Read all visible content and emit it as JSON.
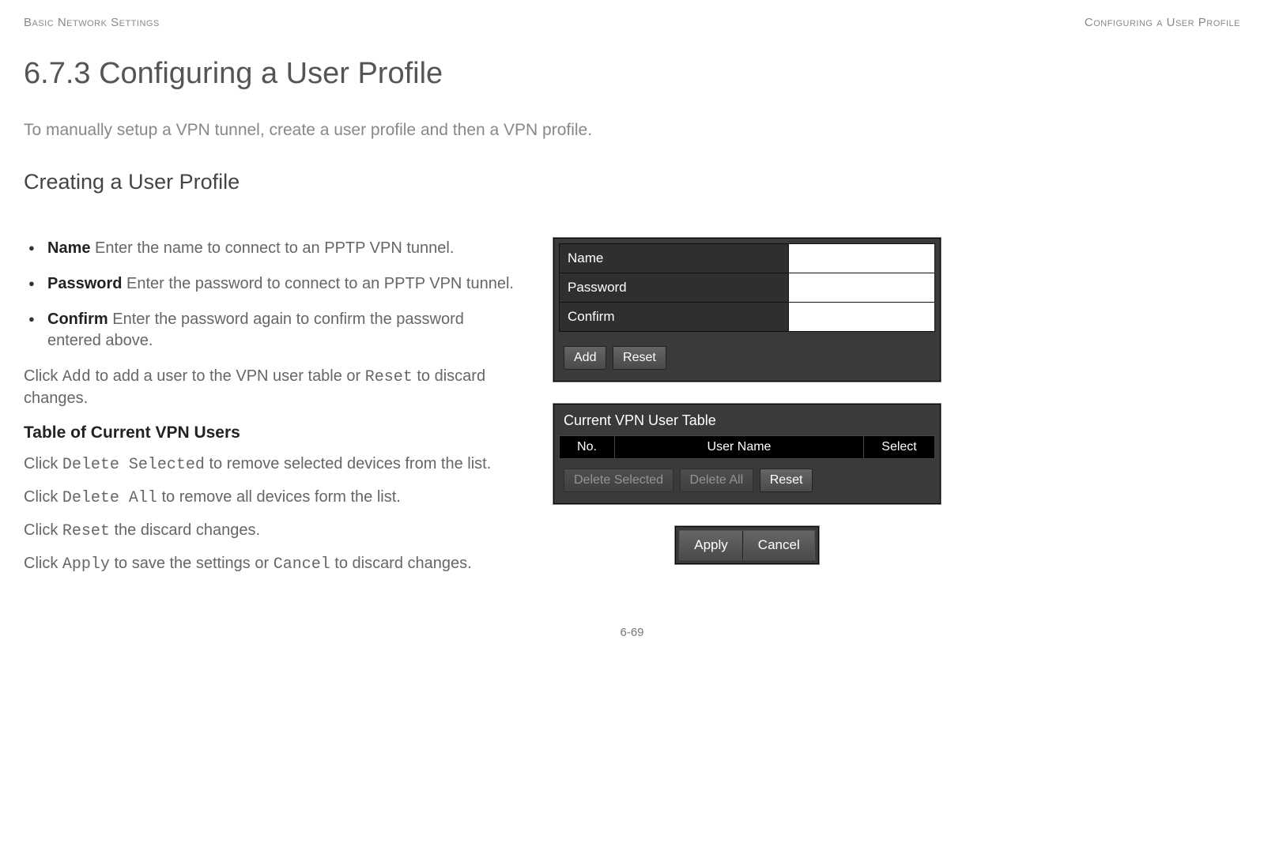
{
  "header": {
    "left": "Basic Network Settings",
    "right": "Configuring a User Profile"
  },
  "title": "6.7.3 Configuring a User Profile",
  "intro": "To manually setup a VPN tunnel, create a user profile and then a VPN profile.",
  "subtitle": "Creating a User Profile",
  "bullets": [
    {
      "label": "Name",
      "text": "  Enter the name to connect to an PPTP VPN tunnel."
    },
    {
      "label": "Password",
      "text": "  Enter the password to connect to an PPTP VPN tunnel."
    },
    {
      "label": "Confirm",
      "text": "  Enter the password again to confirm the password entered above."
    }
  ],
  "para_add": {
    "pre": "Click ",
    "m1": "Add",
    "mid": " to add a user to the VPN user table or ",
    "m2": "Reset",
    "post": " to discard changes."
  },
  "subhead": "Table of Current VPN Users",
  "para_del_sel": {
    "pre": "Click ",
    "m1": "Delete Selected",
    "post": " to remove selected devices from the list."
  },
  "para_del_all": {
    "pre": "Click ",
    "m1": "Delete All",
    "post": " to remove all devices form the list."
  },
  "para_reset": {
    "pre": "Click ",
    "m1": "Reset",
    "post": " the discard changes."
  },
  "para_apply": {
    "pre": "Click ",
    "m1": "Apply",
    "mid": " to save the settings or ",
    "m2": "Cancel",
    "post": " to discard changes."
  },
  "panel1": {
    "rows": [
      "Name",
      "Password",
      "Confirm"
    ],
    "add": "Add",
    "reset": "Reset"
  },
  "panel2": {
    "title": "Current VPN User Table",
    "cols": [
      "No.",
      "User Name",
      "Select"
    ],
    "del_sel": "Delete Selected",
    "del_all": "Delete All",
    "reset": "Reset"
  },
  "panel3": {
    "apply": "Apply",
    "cancel": "Cancel"
  },
  "pagenum": "6-69"
}
